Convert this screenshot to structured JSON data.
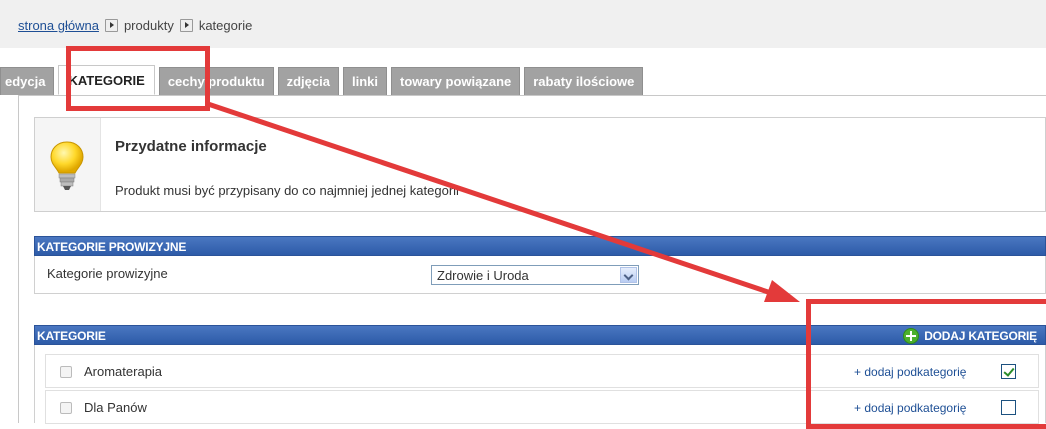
{
  "breadcrumb": {
    "home": "strona główna",
    "items": [
      "produkty",
      "kategorie"
    ]
  },
  "tabs": [
    {
      "label": "edycja",
      "active": false
    },
    {
      "label": "KATEGORIE",
      "active": true
    },
    {
      "label": "cechy produktu",
      "active": false
    },
    {
      "label": "zdjęcia",
      "active": false
    },
    {
      "label": "linki",
      "active": false
    },
    {
      "label": "towary powiązane",
      "active": false
    },
    {
      "label": "rabaty ilościowe",
      "active": false
    }
  ],
  "info": {
    "icon": "lightbulb-icon",
    "title": "Przydatne informacje",
    "text": "Produkt musi być przypisany do co najmniej jednej kategorii"
  },
  "commission": {
    "header": "KATEGORIE PROWIZYJNE",
    "label": "Kategorie prowizyjne",
    "selected": "Zdrowie i Uroda"
  },
  "categories": {
    "header": "KATEGORIE",
    "add_label": "DODAJ KATEGORIĘ",
    "add_subcategory_label": "+ dodaj podkategorię",
    "items": [
      {
        "name": "Aromaterapia",
        "checked": true
      },
      {
        "name": "Dla Panów",
        "checked": false
      }
    ]
  },
  "colors": {
    "header_blue": "#2d5ba8",
    "annotation_red": "#e33a3a",
    "tab_gray": "#a2a2a2"
  }
}
